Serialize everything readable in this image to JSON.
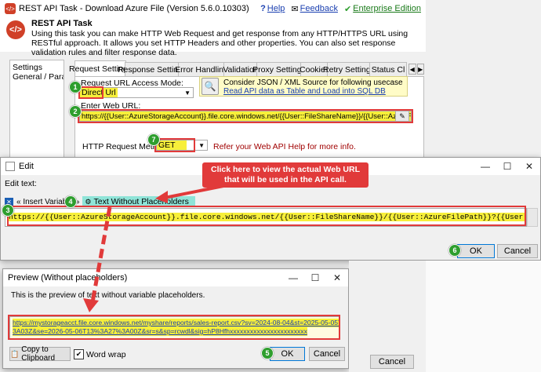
{
  "main_window": {
    "title": "REST API Task - Download Azure File (Version 5.6.0.10303)",
    "help_label": "Help",
    "feedback_label": "Feedback",
    "edition_label": "Enterprise Edition",
    "header_title": "REST API Task",
    "header_desc": "Using this task you can make HTTP Web Request and get response from any HTTP/HTTPS URL using RESTful approach. It allows you set HTTP Headers and other properties. You can also set response validation rules and filter response data.",
    "sidebar_items": [
      "Settings",
      "General / Paramete"
    ],
    "tabs": [
      "Request Settings",
      "Response Settings",
      "Error Handling",
      "Validation",
      "Proxy Settings",
      "Cookies",
      "Retry Settings",
      "Status Cl"
    ],
    "access_mode_label": "Request URL Access Mode:",
    "access_mode_value": "Direct Url",
    "json_hint": "Consider JSON / XML Source for following usecase",
    "json_link": "Read API data as Table and Load into SQL DB",
    "url_label": "Enter Web URL:",
    "url_value": "https://{{User::AzureStorageAccount}}.file.core.windows.net/{{User::FileShareName}}/{{User::AzureFilePath}}?{{User::S",
    "method_label": "HTTP Request Method:",
    "method_value": "GET",
    "method_help": "Refer your Web API Help for more info."
  },
  "edit_window": {
    "title": "Edit",
    "edit_text_label": "Edit text:",
    "insert_variable_label": "« Insert Variable »",
    "text_without_placeholders_label": "Text Without Placeholders",
    "url_text": "https://{{User::AzureStorageAccount}}.file.core.windows.net/{{User::FileShareName}}/{{User::AzureFilePath}}?{{User::SASToken}}",
    "ok_label": "OK",
    "cancel_label": "Cancel"
  },
  "preview_window": {
    "title": "Preview (Without placeholders)",
    "desc": "This is the preview of text without variable placeholders.",
    "url_line1": "https://mystorageacct.file.core.windows.net/myshare/reports/sales-report.csv?sv=2024-08-04&st=2025-05-05T13%3A27%",
    "url_line2": "3A03Z&se=2026-05-06T13%3A27%3A00Z&sr=s&sp=rcwdl&sig=hP8Hfhxxxxxxxxxxxxxxxxxxxxxxx",
    "copy_label": "Copy to Clipboard",
    "wordwrap_label": "Word wrap",
    "ok_label": "OK",
    "cancel_label": "Cancel"
  },
  "callout": {
    "text": "Click here to view the actual Web URL that will be used in the API call."
  },
  "badges": [
    "1",
    "2",
    "3",
    "4",
    "5",
    "6",
    "7"
  ],
  "colors": {
    "highlight_yellow": "#f7ef3a",
    "badge_green": "#2e9e2e",
    "callout_red": "#e13a3a",
    "link_blue": "#1a3fb0",
    "help_red": "#a00000"
  }
}
